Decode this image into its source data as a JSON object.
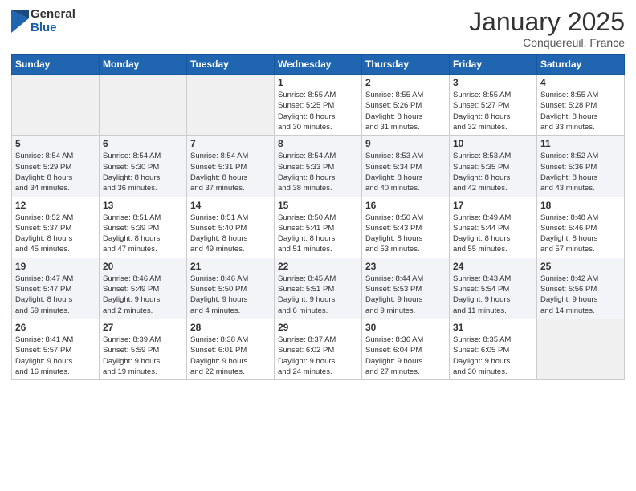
{
  "logo": {
    "general": "General",
    "blue": "Blue"
  },
  "header": {
    "month": "January 2025",
    "location": "Conquereuil, France"
  },
  "weekdays": [
    "Sunday",
    "Monday",
    "Tuesday",
    "Wednesday",
    "Thursday",
    "Friday",
    "Saturday"
  ],
  "weeks": [
    [
      {
        "day": "",
        "info": ""
      },
      {
        "day": "",
        "info": ""
      },
      {
        "day": "",
        "info": ""
      },
      {
        "day": "1",
        "info": "Sunrise: 8:55 AM\nSunset: 5:25 PM\nDaylight: 8 hours\nand 30 minutes."
      },
      {
        "day": "2",
        "info": "Sunrise: 8:55 AM\nSunset: 5:26 PM\nDaylight: 8 hours\nand 31 minutes."
      },
      {
        "day": "3",
        "info": "Sunrise: 8:55 AM\nSunset: 5:27 PM\nDaylight: 8 hours\nand 32 minutes."
      },
      {
        "day": "4",
        "info": "Sunrise: 8:55 AM\nSunset: 5:28 PM\nDaylight: 8 hours\nand 33 minutes."
      }
    ],
    [
      {
        "day": "5",
        "info": "Sunrise: 8:54 AM\nSunset: 5:29 PM\nDaylight: 8 hours\nand 34 minutes."
      },
      {
        "day": "6",
        "info": "Sunrise: 8:54 AM\nSunset: 5:30 PM\nDaylight: 8 hours\nand 36 minutes."
      },
      {
        "day": "7",
        "info": "Sunrise: 8:54 AM\nSunset: 5:31 PM\nDaylight: 8 hours\nand 37 minutes."
      },
      {
        "day": "8",
        "info": "Sunrise: 8:54 AM\nSunset: 5:33 PM\nDaylight: 8 hours\nand 38 minutes."
      },
      {
        "day": "9",
        "info": "Sunrise: 8:53 AM\nSunset: 5:34 PM\nDaylight: 8 hours\nand 40 minutes."
      },
      {
        "day": "10",
        "info": "Sunrise: 8:53 AM\nSunset: 5:35 PM\nDaylight: 8 hours\nand 42 minutes."
      },
      {
        "day": "11",
        "info": "Sunrise: 8:52 AM\nSunset: 5:36 PM\nDaylight: 8 hours\nand 43 minutes."
      }
    ],
    [
      {
        "day": "12",
        "info": "Sunrise: 8:52 AM\nSunset: 5:37 PM\nDaylight: 8 hours\nand 45 minutes."
      },
      {
        "day": "13",
        "info": "Sunrise: 8:51 AM\nSunset: 5:39 PM\nDaylight: 8 hours\nand 47 minutes."
      },
      {
        "day": "14",
        "info": "Sunrise: 8:51 AM\nSunset: 5:40 PM\nDaylight: 8 hours\nand 49 minutes."
      },
      {
        "day": "15",
        "info": "Sunrise: 8:50 AM\nSunset: 5:41 PM\nDaylight: 8 hours\nand 51 minutes."
      },
      {
        "day": "16",
        "info": "Sunrise: 8:50 AM\nSunset: 5:43 PM\nDaylight: 8 hours\nand 53 minutes."
      },
      {
        "day": "17",
        "info": "Sunrise: 8:49 AM\nSunset: 5:44 PM\nDaylight: 8 hours\nand 55 minutes."
      },
      {
        "day": "18",
        "info": "Sunrise: 8:48 AM\nSunset: 5:46 PM\nDaylight: 8 hours\nand 57 minutes."
      }
    ],
    [
      {
        "day": "19",
        "info": "Sunrise: 8:47 AM\nSunset: 5:47 PM\nDaylight: 8 hours\nand 59 minutes."
      },
      {
        "day": "20",
        "info": "Sunrise: 8:46 AM\nSunset: 5:49 PM\nDaylight: 9 hours\nand 2 minutes."
      },
      {
        "day": "21",
        "info": "Sunrise: 8:46 AM\nSunset: 5:50 PM\nDaylight: 9 hours\nand 4 minutes."
      },
      {
        "day": "22",
        "info": "Sunrise: 8:45 AM\nSunset: 5:51 PM\nDaylight: 9 hours\nand 6 minutes."
      },
      {
        "day": "23",
        "info": "Sunrise: 8:44 AM\nSunset: 5:53 PM\nDaylight: 9 hours\nand 9 minutes."
      },
      {
        "day": "24",
        "info": "Sunrise: 8:43 AM\nSunset: 5:54 PM\nDaylight: 9 hours\nand 11 minutes."
      },
      {
        "day": "25",
        "info": "Sunrise: 8:42 AM\nSunset: 5:56 PM\nDaylight: 9 hours\nand 14 minutes."
      }
    ],
    [
      {
        "day": "26",
        "info": "Sunrise: 8:41 AM\nSunset: 5:57 PM\nDaylight: 9 hours\nand 16 minutes."
      },
      {
        "day": "27",
        "info": "Sunrise: 8:39 AM\nSunset: 5:59 PM\nDaylight: 9 hours\nand 19 minutes."
      },
      {
        "day": "28",
        "info": "Sunrise: 8:38 AM\nSunset: 6:01 PM\nDaylight: 9 hours\nand 22 minutes."
      },
      {
        "day": "29",
        "info": "Sunrise: 8:37 AM\nSunset: 6:02 PM\nDaylight: 9 hours\nand 24 minutes."
      },
      {
        "day": "30",
        "info": "Sunrise: 8:36 AM\nSunset: 6:04 PM\nDaylight: 9 hours\nand 27 minutes."
      },
      {
        "day": "31",
        "info": "Sunrise: 8:35 AM\nSunset: 6:05 PM\nDaylight: 9 hours\nand 30 minutes."
      },
      {
        "day": "",
        "info": ""
      }
    ]
  ]
}
